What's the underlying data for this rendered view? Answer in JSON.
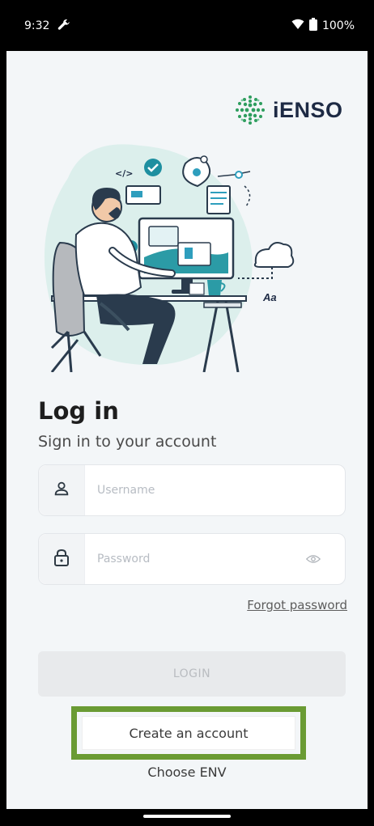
{
  "status_bar": {
    "time": "9:32",
    "battery": "100%"
  },
  "brand": {
    "name": "iENSO",
    "accent_color": "#2e9e5e"
  },
  "login": {
    "title": "Log in",
    "subtitle": "Sign in to your account",
    "username_placeholder": "Username",
    "password_placeholder": "Password",
    "forgot_password": "Forgot password",
    "login_button": "LOGIN",
    "create_account": "Create an account",
    "choose_env": "Choose ENV"
  },
  "icons": {
    "username": "user-icon",
    "password": "lock-icon",
    "visibility": "eye-icon",
    "status_wrench": "wrench-icon",
    "wifi": "wifi-icon",
    "battery": "battery-icon"
  },
  "highlight_color": "#6a9b34"
}
